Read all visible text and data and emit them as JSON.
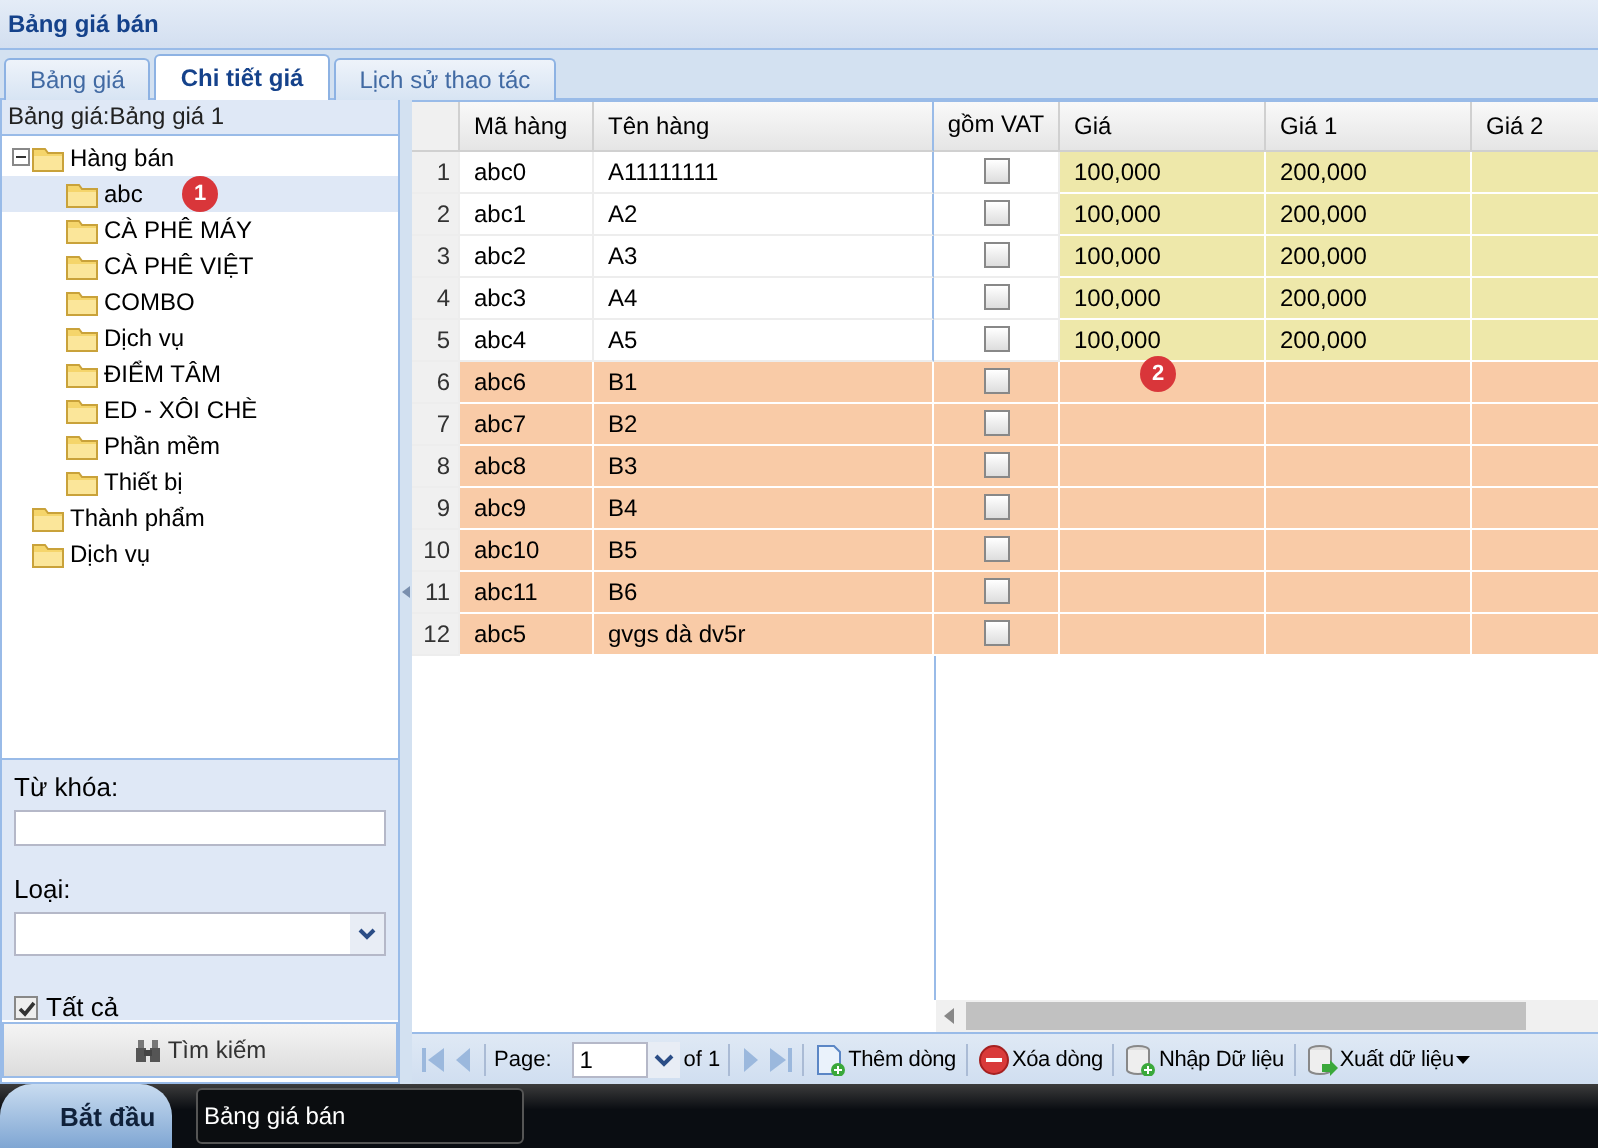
{
  "window": {
    "title": "Bảng giá bán"
  },
  "tabs": [
    {
      "label": "Bảng giá",
      "selected": false
    },
    {
      "label": "Chi tiết giá",
      "selected": true
    },
    {
      "label": "Lịch sử thao tác",
      "selected": false
    }
  ],
  "price_list": {
    "header": "Bảng giá:Bảng giá 1",
    "tree": [
      {
        "label": "Hàng bán",
        "expanded": true,
        "selected": false,
        "children": [
          {
            "label": "abc",
            "selected": true,
            "badge": "1"
          },
          {
            "label": "CÀ PHÊ MÁY",
            "selected": false
          },
          {
            "label": "CÀ PHÊ VIỆT",
            "selected": false
          },
          {
            "label": "COMBO",
            "selected": false
          },
          {
            "label": "Dịch vụ",
            "selected": false
          },
          {
            "label": "ĐIỂM TÂM",
            "selected": false
          },
          {
            "label": "ED - XÔI CHÈ",
            "selected": false
          },
          {
            "label": "Phần mềm",
            "selected": false
          },
          {
            "label": "Thiết bị",
            "selected": false
          }
        ]
      },
      {
        "label": "Thành phẩm",
        "selected": false
      },
      {
        "label": "Dịch vụ",
        "selected": false
      }
    ]
  },
  "search": {
    "keyword_label": "Từ khóa:",
    "type_label": "Loại:",
    "all_label": "Tất cả",
    "all_checked": true,
    "button": "Tìm kiếm"
  },
  "table": {
    "columns": [
      "Mã hàng",
      "Tên hàng",
      "gồm VAT",
      "Giá",
      "Giá 1",
      "Giá 2"
    ],
    "rows": [
      {
        "number": "1",
        "code": "abc0",
        "name": "A11111111",
        "vat": false,
        "price": "100,000",
        "price_1": "200,000",
        "highlighted": false
      },
      {
        "number": "2",
        "code": "abc1",
        "name": "A2",
        "vat": false,
        "price": "100,000",
        "price_1": "200,000",
        "highlighted": false
      },
      {
        "number": "3",
        "code": "abc2",
        "name": "A3",
        "vat": false,
        "price": "100,000",
        "price_1": "200,000",
        "highlighted": false
      },
      {
        "number": "4",
        "code": "abc3",
        "name": "A4",
        "vat": false,
        "price": "100,000",
        "price_1": "200,000",
        "highlighted": false
      },
      {
        "number": "5",
        "code": "abc4",
        "name": "A5",
        "vat": false,
        "price": "100,000",
        "price_1": "200,000",
        "highlighted": false
      },
      {
        "number": "6",
        "code": "abc6",
        "name": "B1",
        "vat": false,
        "highlighted": true,
        "badge": "2"
      },
      {
        "number": "7",
        "code": "abc7",
        "name": "B2",
        "vat": false,
        "highlighted": true
      },
      {
        "number": "8",
        "code": "abc8",
        "name": "B3",
        "vat": false,
        "highlighted": true
      },
      {
        "number": "9",
        "code": "abc9",
        "name": "B4",
        "vat": false,
        "highlighted": true
      },
      {
        "number": "10",
        "code": "abc10",
        "name": "B5",
        "vat": false,
        "highlighted": true
      },
      {
        "number": "11",
        "code": "abc11",
        "name": "B6",
        "vat": false,
        "highlighted": true
      },
      {
        "number": "12",
        "code": "abc5",
        "name": "gvgs dà dv5r",
        "vat": false,
        "highlighted": true
      }
    ]
  },
  "pager": {
    "page_label": "Page:",
    "page": "1",
    "total": "of 1"
  },
  "toolbar": [
    {
      "label": "Thêm dòng",
      "kind": "add",
      "dropdown": false
    },
    {
      "label": "Xóa dòng",
      "kind": "delete",
      "dropdown": false
    },
    {
      "label": "Nhập Dữ liệu",
      "kind": "import",
      "dropdown": false
    },
    {
      "label": "Xuất dữ liệu",
      "kind": "export",
      "dropdown": true
    }
  ],
  "taskbar": {
    "start": "Bắt đầu",
    "window": "Bảng giá bán"
  }
}
